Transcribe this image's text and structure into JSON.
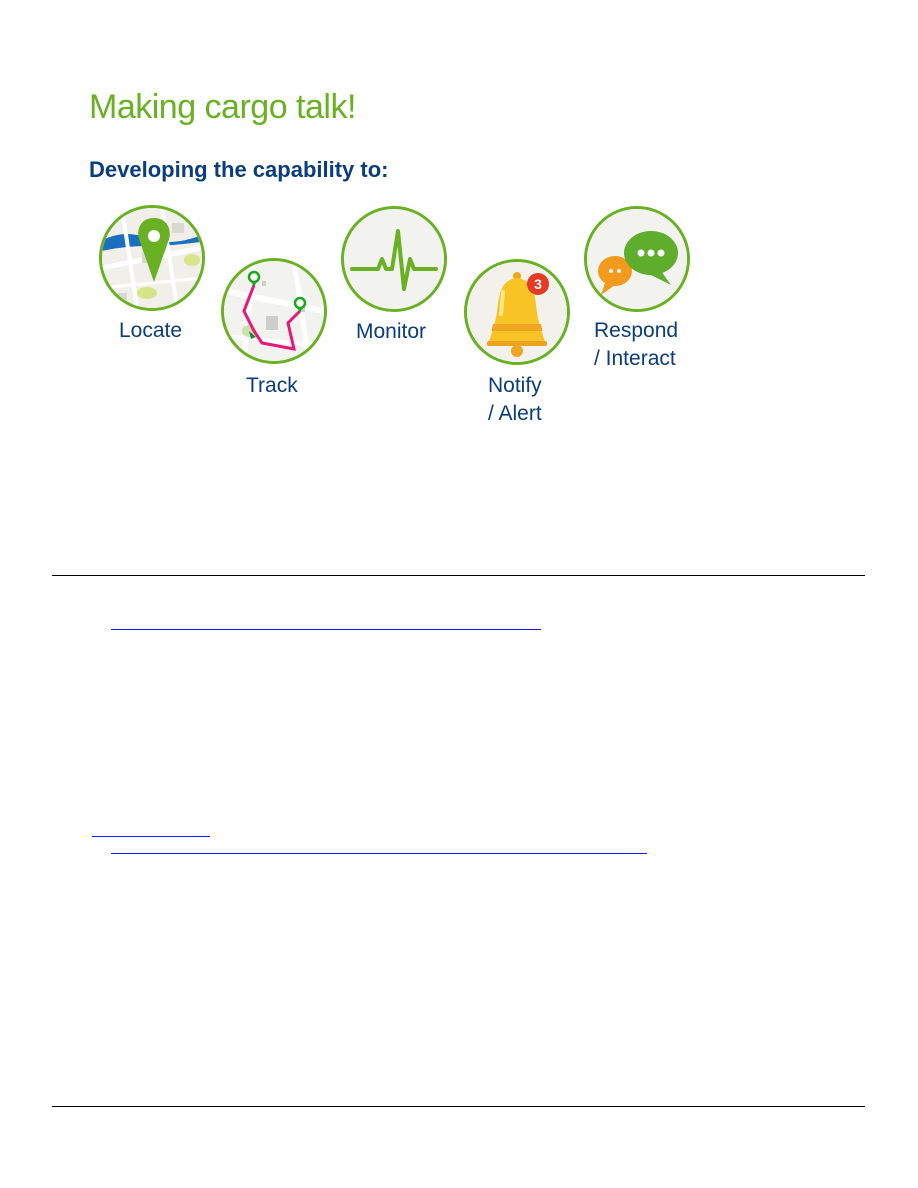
{
  "heading": "Making cargo talk!",
  "subheading": "Developing the capability to:",
  "capabilities": [
    {
      "label": "Locate",
      "icon": "map-pin-icon"
    },
    {
      "label": "Track",
      "icon": "route-map-icon"
    },
    {
      "label": "Monitor",
      "icon": "heartbeat-icon"
    },
    {
      "label_line1": "Notify",
      "label_line2": "/ Alert",
      "icon": "bell-icon",
      "badge": "3"
    },
    {
      "label_line1": "Respond",
      "label_line2": "/ Interact",
      "icon": "chat-bubbles-icon"
    }
  ],
  "colors": {
    "heading": "#6ab023",
    "text": "#0b3d7a",
    "ring": "#6ab023",
    "route": "#e8187a",
    "bell": "#f7c325",
    "badge": "#e53a23",
    "link": "#1a1aff"
  }
}
